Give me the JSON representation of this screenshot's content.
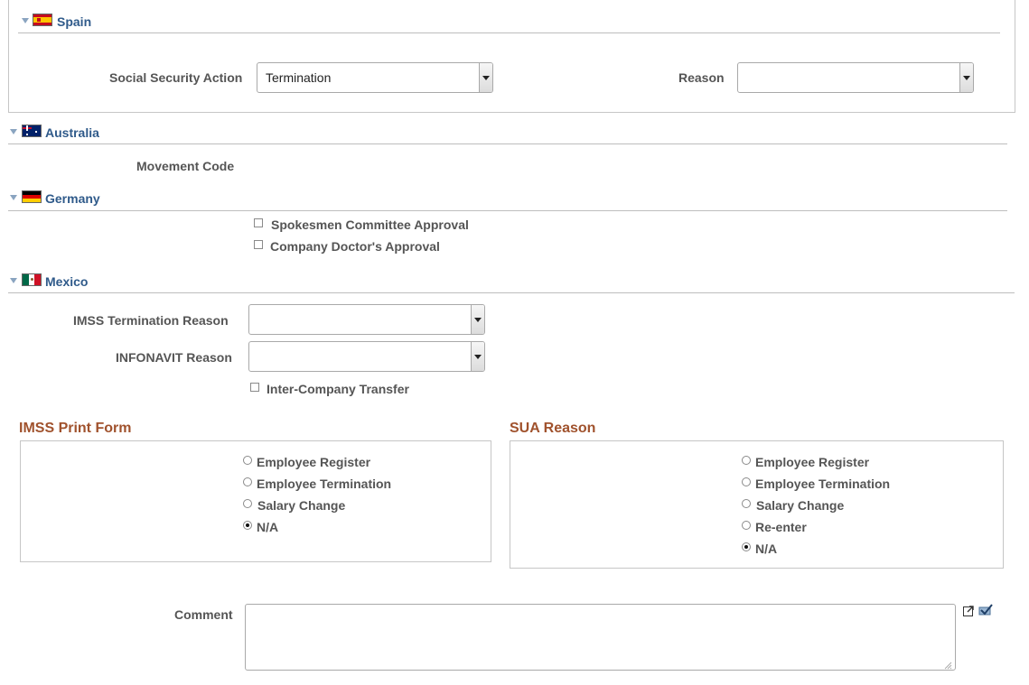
{
  "spain": {
    "title": "Spain",
    "social_security_action_label": "Social Security Action",
    "social_security_action_value": "Termination",
    "reason_label": "Reason",
    "reason_value": ""
  },
  "australia": {
    "title": "Australia",
    "movement_code_label": "Movement Code"
  },
  "germany": {
    "title": "Germany",
    "spokesmen_label": "Spokesmen Committee Approval",
    "spokesmen_checked": false,
    "doctor_label": "Company Doctor's Approval",
    "doctor_checked": false
  },
  "mexico": {
    "title": "Mexico",
    "imss_termination_reason_label": "IMSS Termination Reason",
    "imss_termination_reason_value": "",
    "infonavit_reason_label": "INFONAVIT Reason",
    "infonavit_reason_value": "",
    "inter_company_label": "Inter-Company Transfer",
    "inter_company_checked": false
  },
  "imss_print_form": {
    "title": "IMSS Print Form",
    "options": [
      "Employee Register",
      "Employee Termination",
      "Salary Change",
      "N/A"
    ],
    "selected": "N/A"
  },
  "sua_reason": {
    "title": "SUA Reason",
    "options": [
      "Employee Register",
      "Employee Termination",
      "Salary Change",
      "Re-enter",
      "N/A"
    ],
    "selected": "N/A"
  },
  "comment": {
    "label": "Comment",
    "value": ""
  },
  "colors": {
    "section_title": "#2f5a8a",
    "group_title": "#a0522d",
    "label": "#555555"
  }
}
